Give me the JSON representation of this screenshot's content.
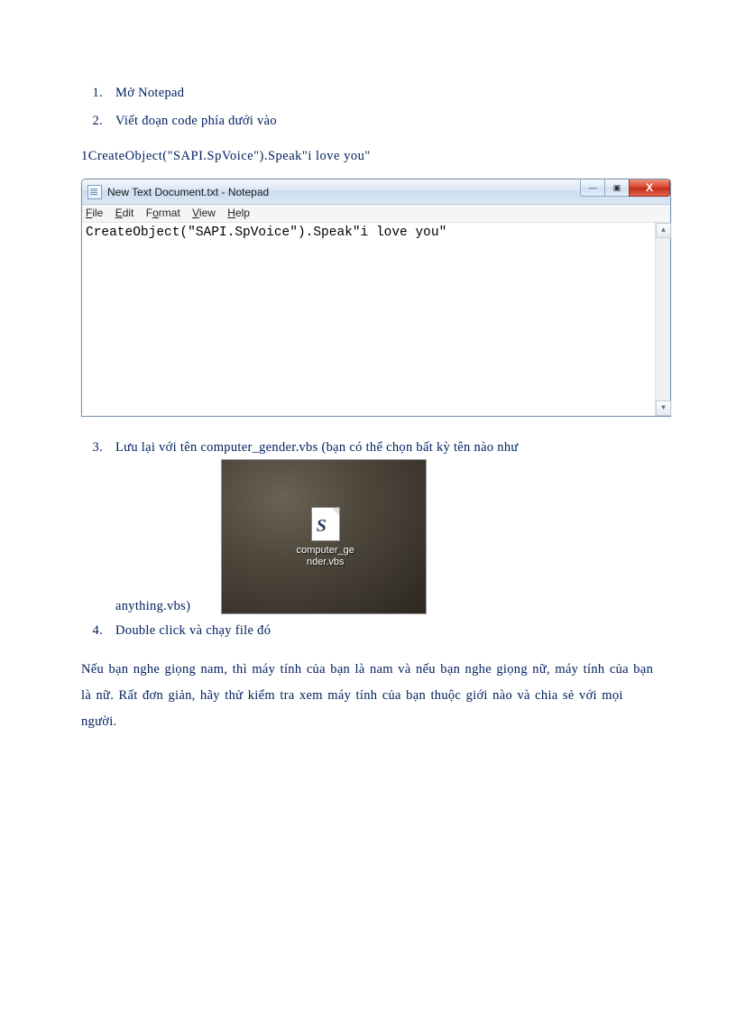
{
  "steps": {
    "s1": {
      "num": "1.",
      "text": "Mở Notepad"
    },
    "s2": {
      "num": "2.",
      "text": "Viết đoạn code phía dưới vào"
    },
    "s3": {
      "num": "3.",
      "text_a": "Lưu lại với tên computer_gender.vbs  (bạn có thể chọn bất kỳ tên nào như",
      "text_b": "anything.vbs)"
    },
    "s4": {
      "num": "4.",
      "text": "Double click và chạy file đó"
    }
  },
  "code_line": "1CreateObject(\"SAPI.SpVoice\").Speak\"i   love you\"",
  "notepad": {
    "title": "New Text Document.txt - Notepad",
    "menu": {
      "file": {
        "u": "F",
        "rest": "ile"
      },
      "edit": {
        "u": "E",
        "rest": "dit"
      },
      "format": {
        "u": "o",
        "pre": "F",
        "rest": "rmat"
      },
      "view": {
        "u": "V",
        "rest": "iew"
      },
      "help": {
        "u": "H",
        "rest": "elp"
      }
    },
    "content": "CreateObject(\"SAPI.SpVoice\").Speak\"i love you\"",
    "controls": {
      "min": "—",
      "max": "▣",
      "close": "X"
    }
  },
  "desktop_icon": {
    "glyph": "S",
    "line1": "computer_ge",
    "line2": "nder.vbs"
  },
  "paragraph": "Nếu bạn nghe giọng nam, thì máy tính của bạn là nam và nếu bạn nghe giọng nữ, máy tính của bạn là nữ. Rất đơn giản, hãy thử kiểm tra xem máy tính của bạn thuộc giới nào và chia sẻ với mọi người."
}
